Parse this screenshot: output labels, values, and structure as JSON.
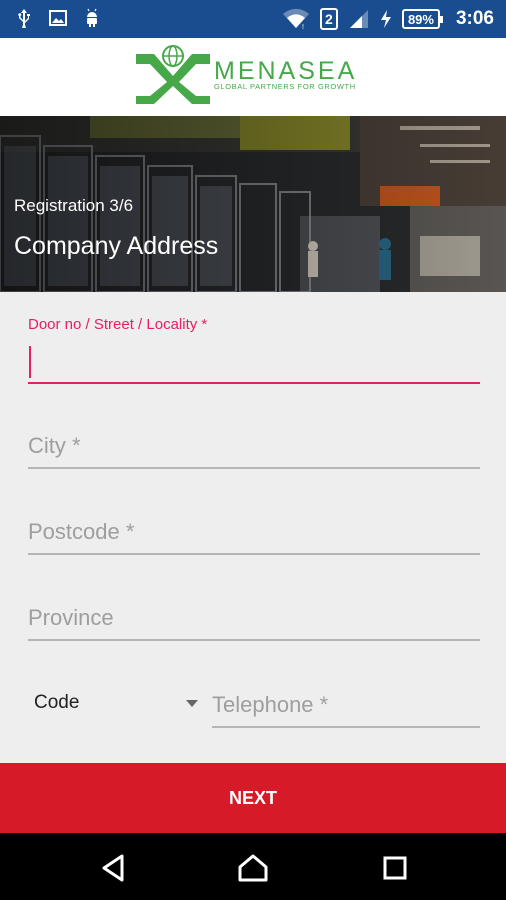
{
  "status_bar": {
    "left_icons": [
      "usb-icon",
      "image-icon",
      "android-icon"
    ],
    "sim_slot": "2",
    "battery_level": "89%",
    "time": "3:06"
  },
  "logo": {
    "brand": "MENASEA",
    "tagline": "GLOBAL PARTNERS FOR GROWTH"
  },
  "hero": {
    "step": "Registration 3/6",
    "title": "Company Address"
  },
  "form": {
    "street": {
      "label": "Door no / Street / Locality *",
      "value": ""
    },
    "city": {
      "placeholder": "City *"
    },
    "postcode": {
      "placeholder": "Postcode *"
    },
    "province": {
      "placeholder": "Province"
    },
    "code": {
      "selected": "Code"
    },
    "telephone": {
      "placeholder": "Telephone *"
    }
  },
  "next_button": {
    "label": "NEXT"
  },
  "colors": {
    "status_bar": "#1a4d8f",
    "accent_pink": "#e91e63",
    "next_red": "#d71a28",
    "brand_green": "#47a84a"
  },
  "nav": [
    "back-icon",
    "home-icon",
    "recents-icon"
  ]
}
